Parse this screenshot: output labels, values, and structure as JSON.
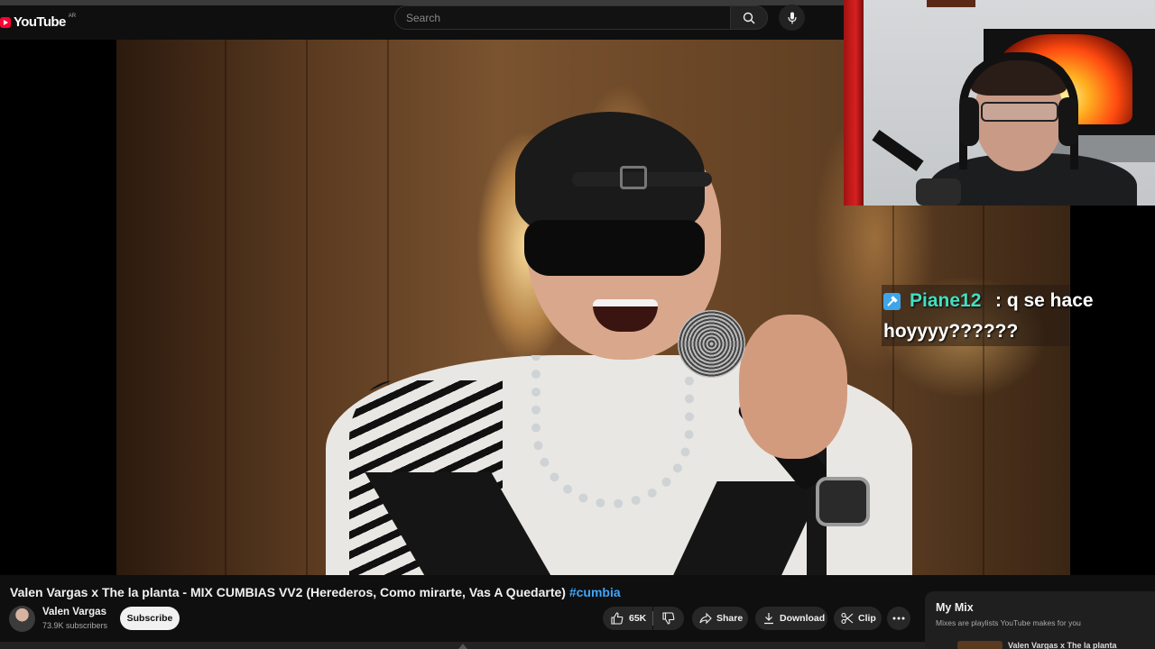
{
  "masthead": {
    "logo_text": "YouTube",
    "country_code": "AR",
    "search_placeholder": "Search"
  },
  "stream_overlay": {
    "chat": {
      "username": "Piane12",
      "message_line1": ": q se hace",
      "message_line2": "hoyyyy??????",
      "username_color": "#41e0c2"
    }
  },
  "video": {
    "title": "Valen Vargas x The la planta - MIX CUMBIAS VV2 (Herederos, Como mirarte, Vas A Quedarte)",
    "hashtag": "#cumbia",
    "channel_name": "Valen Vargas",
    "subscribers": "73.9K subscribers",
    "subscribe_label": "Subscribe"
  },
  "actions": {
    "like_count": "65K",
    "share_label": "Share",
    "download_label": "Download",
    "clip_label": "Clip"
  },
  "sidebar": {
    "mix_title": "My Mix",
    "mix_description": "Mixes are playlists YouTube makes for you",
    "next_item": "Valen Vargas x The la planta"
  },
  "colors": {
    "brand_red": "#ff0033",
    "link_blue": "#3ea6ff",
    "background": "#0f0f0f"
  }
}
